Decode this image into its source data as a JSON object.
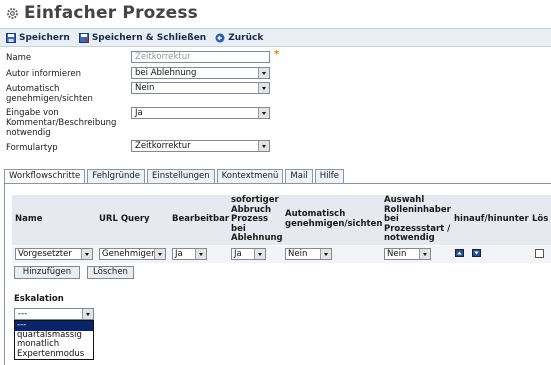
{
  "header": {
    "title": "Einfacher Prozess"
  },
  "toolbar": {
    "save_label": "Speichern",
    "save_close_label": "Speichern & Schließen",
    "back_label": "Zurück"
  },
  "form": {
    "name": {
      "label": "Name",
      "value": "Zeitkorrektur",
      "required_mark": "*"
    },
    "autor": {
      "label": "Autor informieren",
      "value": "bei Ablehnung"
    },
    "auto_approve": {
      "label_line1": "Automatisch",
      "label_line2": "genehmigen/sichten",
      "value": "Nein"
    },
    "comment": {
      "label_line1": "Eingabe von",
      "label_line2": "Kommentar/Beschreibung",
      "label_line3": "notwendig",
      "value": "Ja"
    },
    "formtype": {
      "label": "Formulartyp",
      "value": "Zeitkorrektur"
    }
  },
  "tabs": [
    "Workflowschritte",
    "Fehlgründe",
    "Einstellungen",
    "Kontextmenü",
    "Mail",
    "Hilfe"
  ],
  "grid": {
    "headers": {
      "name": "Name",
      "url_query": "URL Query",
      "bearbeitbar": "Bearbeitbar",
      "abbruch": [
        "sofortiger",
        "Abbruch",
        "Prozess",
        "bei",
        "Ablehnung"
      ],
      "auto": [
        "Automatisch",
        "genehmigen/sichten"
      ],
      "auswahl": [
        "Auswahl",
        "Rolleninhaber",
        "bei",
        "Prozessstart /",
        "notwendig"
      ],
      "hinauf": "hinauf/hinunter",
      "loeschen": "Lös"
    },
    "row": {
      "name": "Vorgesetzter",
      "url_query": "Genehmigen",
      "bearbeitbar": "Ja",
      "abbruch": "Ja",
      "auto": "Nein",
      "auswahl": "Nein"
    }
  },
  "buttons": {
    "add": "Hinzufügen",
    "delete": "Löschen"
  },
  "escalation": {
    "label": "Eskalation",
    "selected": "---",
    "options": [
      "---",
      "quartalsmässig",
      "monatlich",
      "Expertenmodus"
    ]
  }
}
